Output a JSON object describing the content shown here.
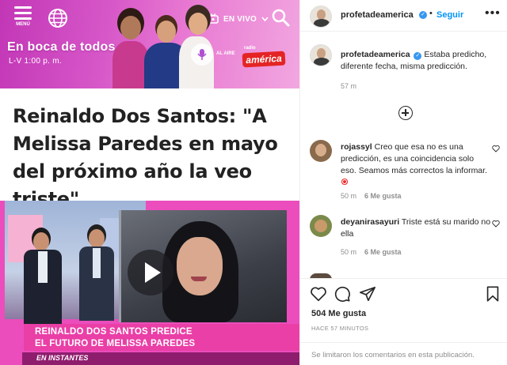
{
  "site": {
    "menu_label": "MENÚ",
    "live_label": "EN VIVO",
    "show_title": "En boca de todos",
    "show_time": "L-V 1:00 p. m.",
    "on_air_label": "AL AIRE",
    "radio_small": "radio",
    "radio_name": "américa",
    "brand_color": "#d13bbd",
    "icons": [
      "menu-icon",
      "globe-icon",
      "tv-icon",
      "chevron-down-icon",
      "search-icon",
      "microphone-icon"
    ]
  },
  "headline": "Reinaldo Dos Santos: \"A Melissa Paredes en mayo del próximo año la veo triste\"",
  "video": {
    "ticker_line1": "REINALDO DOS SANTOS PREDICE",
    "ticker_line2": "EL FUTURO DE MELISSA PAREDES",
    "ticker_logo": "EN",
    "ticker_sub": "EN INSTANTES",
    "play_icon": "play-icon"
  },
  "post": {
    "username": "profetadeamerica",
    "verified_mark": "✓",
    "follow_label": "Seguir",
    "more_label": "•••",
    "caption_text": "Estaba predicho, diferente fecha, misma predicción.",
    "caption_time": "57 m",
    "load_more_icon": "plus-circle-icon"
  },
  "comments": [
    {
      "username": "rojassyl",
      "text": "Creo que esa no es una predicción, es una coincidencia solo eso. Seamos más correctos la informar.",
      "time": "50 m",
      "likes": "6 Me gusta"
    },
    {
      "username": "deyanirasayuri",
      "text": "Triste está su marido no ella",
      "time": "50 m",
      "likes": "6 Me gusta"
    }
  ],
  "actions": {
    "likes_count": "504 Me gusta",
    "posted_ago": "HACE 57 MINUTOS",
    "comments_limited": "Se limitaron los comentarios en esta publicación.",
    "accent_color": "#0095f6"
  }
}
